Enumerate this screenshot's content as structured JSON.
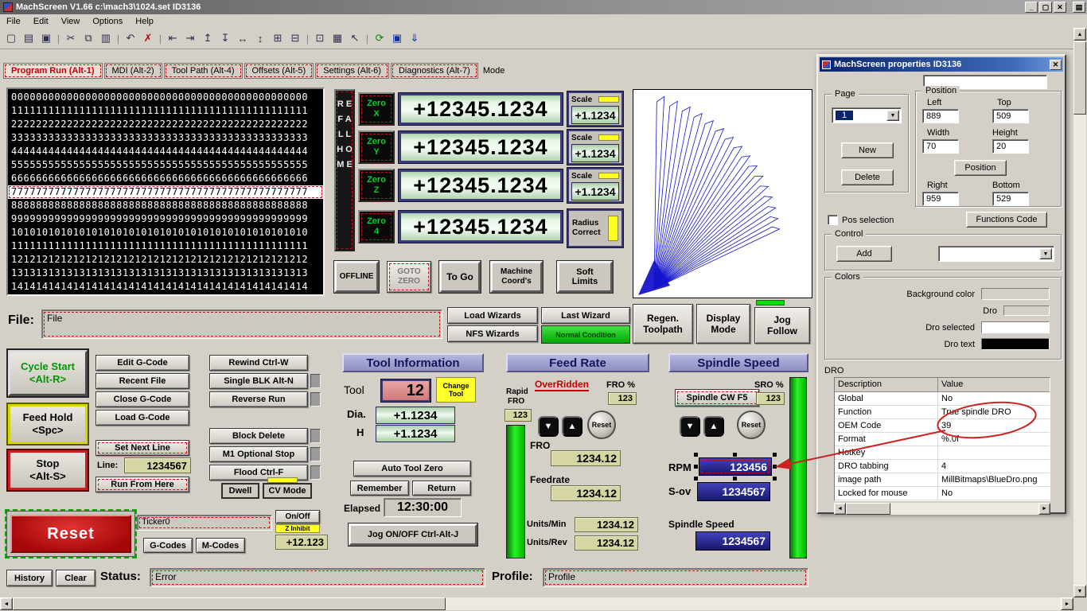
{
  "icons": {
    "up": "▲",
    "down": "▼",
    "left": "◄",
    "right": "►",
    "combo": "▼",
    "slower": "▼",
    "faster": "▲",
    "close": "✕"
  },
  "window": {
    "title": "MachScreen V1.66  c:\\mach3\\1024.set  ID3136",
    "menu": [
      "File",
      "Edit",
      "View",
      "Options",
      "Help"
    ],
    "controls": [
      {
        "name": "minimize-button",
        "glyph": "_"
      },
      {
        "name": "maximize-button",
        "glyph": "▢"
      },
      {
        "name": "close-button",
        "glyph": "✕"
      },
      {
        "name": "extra-button",
        "glyph": "▤",
        "cls": "gap"
      }
    ]
  },
  "toolbar": [
    {
      "name": "new-icon",
      "glyph": "▢"
    },
    {
      "name": "open-icon",
      "glyph": "▤"
    },
    {
      "name": "save-icon",
      "glyph": "▣"
    },
    {
      "name": "separator",
      "glyph": "|",
      "cls": "sep"
    },
    {
      "name": "cut-icon",
      "glyph": "✂"
    },
    {
      "name": "copy-icon",
      "glyph": "⧉"
    },
    {
      "name": "paste-icon",
      "glyph": "▥"
    },
    {
      "name": "separator",
      "glyph": "|",
      "cls": "sep"
    },
    {
      "name": "undo-icon",
      "glyph": "↶"
    },
    {
      "name": "delete-icon",
      "glyph": "✗",
      "cls": "red"
    },
    {
      "name": "separator",
      "glyph": "|",
      "cls": "sep"
    },
    {
      "name": "align-left-icon",
      "glyph": "⇤"
    },
    {
      "name": "align-right-icon",
      "glyph": "⇥"
    },
    {
      "name": "align-top-icon",
      "glyph": "↥"
    },
    {
      "name": "align-bottom-icon",
      "glyph": "↧"
    },
    {
      "name": "same-width-icon",
      "glyph": "↔"
    },
    {
      "name": "same-height-icon",
      "glyph": "↕"
    },
    {
      "name": "center-h-icon",
      "glyph": "⊞"
    },
    {
      "name": "center-v-icon",
      "glyph": "⊟"
    },
    {
      "name": "separator",
      "glyph": "|",
      "cls": "sep"
    },
    {
      "name": "size-icon",
      "glyph": "⊡"
    },
    {
      "name": "grid-icon",
      "glyph": "▦"
    },
    {
      "name": "pointer-icon",
      "glyph": "↖"
    },
    {
      "name": "separator",
      "glyph": "|",
      "cls": "sep"
    },
    {
      "name": "refresh-icon",
      "glyph": "⟳",
      "cls": "green"
    },
    {
      "name": "save-all-icon",
      "glyph": "▣",
      "cls": "blue"
    },
    {
      "name": "apply-icon",
      "glyph": "⇓",
      "cls": "blue"
    }
  ],
  "tabs": {
    "items": [
      {
        "label": "Program Run (Alt-1)",
        "cls": "active"
      },
      {
        "label": "MDI (Alt-2)"
      },
      {
        "label": "Tool Path (Alt-4)"
      },
      {
        "label": "Offsets (Alt-5)"
      },
      {
        "label": "Settings (Alt-6)"
      },
      {
        "label": "Diagnostics (Alt-7)"
      }
    ],
    "mode": "Mode"
  },
  "gcode": {
    "lines": [
      "000000000000000000000000000000000000000000000000",
      "111111111111111111111111111111111111111111111111",
      "222222222222222222222222222222222222222222222222",
      "333333333333333333333333333333333333333333333333",
      "444444444444444444444444444444444444444444444444",
      "555555555555555555555555555555555555555555555555",
      "666666666666666666666666666666666666666666666666",
      "777777777777777777777777777777777777777777777777",
      "888888888888888888888888888888888888888888888888",
      "999999999999999999999999999999999999999999999999",
      "101010101010101010101010101010101010101010101010",
      "111111111111111111111111111111111111111111111111",
      "121212121212121212121212121212121212121212121212",
      "131313131313131313131313131313131313131313131313",
      "141414141414141414141414141414141414141414141414"
    ]
  },
  "axis": {
    "ref_all_home": "R E F A L L H O M E",
    "zero": [
      {
        "l1": "Zero",
        "l2": "X"
      },
      {
        "l1": "Zero",
        "l2": "Y"
      },
      {
        "l1": "Zero",
        "l2": "Z"
      },
      {
        "l1": "Zero",
        "l2": "4"
      }
    ],
    "dros": [
      "+12345.1234",
      "+12345.1234",
      "+12345.1234",
      "+12345.1234"
    ],
    "scale_label": "Scale",
    "scales": [
      "+1.1234",
      "+1.1234",
      "+1.1234"
    ],
    "radius_1": "Radius",
    "radius_2": "Correct"
  },
  "coord": {
    "offline": "OFFLINE",
    "goto_1": "GOTO",
    "goto_2": "ZERO",
    "to_go": "To Go",
    "machine_1": "Machine",
    "machine_2": "Coord's",
    "soft_1": "Soft",
    "soft_2": "Limits"
  },
  "file_row": {
    "label": "File:",
    "value": "File",
    "load_wizards": "Load Wizards",
    "nfs_wizards": "NFS Wizards",
    "last_wizard": "Last Wizard",
    "normal_condition": "Normal Condition",
    "regen_1": "Regen.",
    "regen_2": "Toolpath",
    "display_1": "Display",
    "display_2": "Mode",
    "jog_1": "Jog",
    "jog_2": "Follow"
  },
  "run": {
    "cycle_1": "Cycle Start",
    "cycle_2": "<Alt-R>",
    "hold_1": "Feed Hold",
    "hold_2": "<Spc>",
    "stop_1": "Stop",
    "stop_2": "<Alt-S>",
    "reset": "Reset"
  },
  "gcode_ctl": {
    "edit": "Edit G-Code",
    "recent": "Recent File",
    "close": "Close G-Code",
    "load": "Load G-Code",
    "set_next": "Set Next Line",
    "line_label": "Line:",
    "line_value": "1234567",
    "run_from_here": "Run From Here"
  },
  "options": {
    "rewind": "Rewind Ctrl-W",
    "single_blk": "Single BLK Alt-N",
    "reverse": "Reverse Run",
    "block_delete": "Block Delete",
    "m1": "M1 Optional Stop",
    "flood": "Flood Ctrl-F",
    "dwell": "Dwell",
    "cv_mode": "CV Mode"
  },
  "ticker": {
    "value": "Ticker0",
    "onoff": "On/Off",
    "z_inhibit": "Z Inhibit",
    "z_value": "+12.123",
    "g_codes": "G-Codes",
    "m_codes": "M-Codes"
  },
  "tool": {
    "header": "Tool Information",
    "label": "Tool",
    "value": "12",
    "change_1": "Change",
    "change_2": "Tool",
    "dia_label": "Dia.",
    "dia_value": "+1.1234",
    "h_label": "H",
    "h_value": "+1.1234",
    "auto_zero": "Auto Tool Zero",
    "remember": "Remember",
    "return": "Return",
    "elapsed_label": "Elapsed",
    "elapsed_value": "12:30:00",
    "jog_onoff": "Jog ON/OFF Ctrl-Alt-J"
  },
  "feed": {
    "header": "Feed Rate",
    "overridden": "OverRidden",
    "fro_pct_label": "FRO %",
    "fro_pct_value": "123",
    "rapid": "Rapid",
    "rapid_fro": "FRO",
    "rapid_value": "123",
    "reset": "Reset",
    "fro_label": "FRO",
    "fro_value": "1234.12",
    "feedrate_label": "Feedrate",
    "feedrate_value": "1234.12",
    "units_min_label": "Units/Min",
    "units_min_value": "1234.12",
    "units_rev_label": "Units/Rev",
    "units_rev_value": "1234.12"
  },
  "spindle": {
    "header": "Spindle Speed",
    "cw_button": "Spindle CW F5",
    "sro_pct_label": "SRO %",
    "sro_pct_value": "123",
    "reset": "Reset",
    "rpm_label": "RPM",
    "rpm_value": "123456",
    "sov_label": "S-ov",
    "sov_value": "1234567",
    "speed_label": "Spindle Speed",
    "speed_value": "1234567"
  },
  "statusbar": {
    "history": "History",
    "clear": "Clear",
    "status_label": "Status:",
    "status_value": "Error",
    "profile_label": "Profile:",
    "profile_value": "Profile"
  },
  "properties": {
    "title": "MachScreen properties  ID3136",
    "page_legend": "Page",
    "page_value": "1",
    "new": "New",
    "delete": "Delete",
    "position_legend": "Position",
    "left_label": "Left",
    "left_value": "889",
    "top_label": "Top",
    "top_value": "509",
    "width_label": "Width",
    "width_value": "70",
    "height_label": "Height",
    "height_value": "20",
    "position_button": "Position",
    "right_label": "Right",
    "right_value": "959",
    "bottom_label": "Bottom",
    "bottom_value": "529",
    "pos_selection": "Pos selection",
    "functions_code": "Functions Code",
    "control_legend": "Control",
    "add": "Add",
    "colors_legend": "Colors",
    "colors": [
      {
        "label": "Background color",
        "swatch": "#d4d0c8"
      },
      {
        "label": "Dro",
        "swatch": "#d4d0c8",
        "cls": "sw-small"
      },
      {
        "label": "Dro selected",
        "swatch": "#ffffff"
      },
      {
        "label": "Dro text",
        "swatch": "#000000"
      }
    ],
    "dro_label": "DRO",
    "table_headers": [
      "Description",
      "Value"
    ],
    "table_rows": [
      [
        "Global",
        "No"
      ],
      [
        "Function",
        "True spindle DRO"
      ],
      [
        "OEM Code",
        "39"
      ],
      [
        "Format",
        "%.0f"
      ],
      [
        "Hotkey",
        ""
      ],
      [
        "DRO tabbing",
        "4"
      ],
      [
        "image path",
        "MillBitmaps\\BlueDro.png"
      ],
      [
        "Locked for mouse",
        "No"
      ]
    ]
  }
}
